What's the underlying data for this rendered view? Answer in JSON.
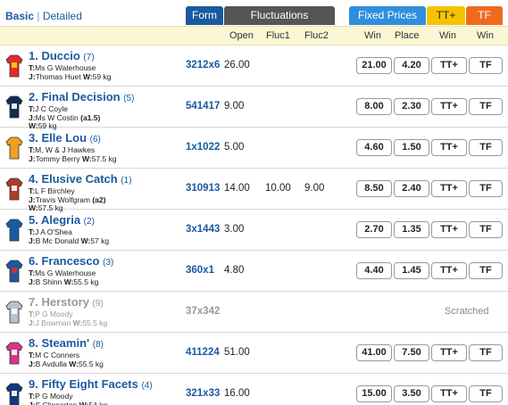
{
  "view_toggle": {
    "basic": "Basic",
    "separator": "|",
    "detailed": "Detailed"
  },
  "header_tabs": {
    "form": "Form",
    "fluctuations": "Fluctuations",
    "fixed_prices": "Fixed Prices",
    "tt_plus": "TT+",
    "tf": "TF"
  },
  "columns": {
    "open": "Open",
    "fluc1": "Fluc1",
    "fluc2": "Fluc2",
    "win": "Win",
    "place": "Place",
    "tt_win": "Win",
    "tf_win": "Win"
  },
  "colors": {
    "accent_blue": "#1a5aa0",
    "fixed_blue": "#2f8fdc",
    "tt_yellow": "#f6c300",
    "tf_orange": "#ee6a1e",
    "header_bg": "#fbf6d4"
  },
  "runners": [
    {
      "name": "1. Duccio",
      "barrier": "(7)",
      "trainer_label": "T:",
      "trainer": "Ms G Waterhouse",
      "jockey_label": "J:",
      "jockey": "Thomas Huet",
      "weight_label": "W:",
      "weight": "59 kg",
      "form": "3212x6",
      "open": "26.00",
      "fluc1": "",
      "fluc2": "",
      "win": "21.00",
      "place": "4.20",
      "tt": "TT+",
      "tf": "TF"
    },
    {
      "name": "2. Final Decision",
      "barrier": "(5)",
      "trainer_label": "T:",
      "trainer": "J C Coyle",
      "jockey_label": "J:",
      "jockey": "Ms W Costin",
      "claim": "(a1.5)",
      "weight_label": "W:",
      "weight": "59 kg",
      "form": "541417",
      "open": "9.00",
      "fluc1": "",
      "fluc2": "",
      "win": "8.00",
      "place": "2.30",
      "tt": "TT+",
      "tf": "TF"
    },
    {
      "name": "3. Elle Lou",
      "barrier": "(6)",
      "trainer_label": "T:",
      "trainer": "M, W & J Hawkes",
      "jockey_label": "J:",
      "jockey": "Tommy Berry",
      "weight_label": "W:",
      "weight": "57.5 kg",
      "form": "1x1022",
      "open": "5.00",
      "fluc1": "",
      "fluc2": "",
      "win": "4.60",
      "place": "1.50",
      "tt": "TT+",
      "tf": "TF"
    },
    {
      "name": "4. Elusive Catch",
      "barrier": "(1)",
      "trainer_label": "T:",
      "trainer": "L F Birchley",
      "jockey_label": "J:",
      "jockey": "Travis Wolfgram",
      "claim": "(a2)",
      "weight_label": "W:",
      "weight": "57.5 kg",
      "form": "310913",
      "open": "14.00",
      "fluc1": "10.00",
      "fluc2": "9.00",
      "win": "8.50",
      "place": "2.40",
      "tt": "TT+",
      "tf": "TF"
    },
    {
      "name": "5. Alegria",
      "barrier": "(2)",
      "trainer_label": "T:",
      "trainer": "J A O'Shea",
      "jockey_label": "J:",
      "jockey": "B Mc Donald",
      "weight_label": "W:",
      "weight": "57 kg",
      "form": "3x1443",
      "open": "3.00",
      "fluc1": "",
      "fluc2": "",
      "win": "2.70",
      "place": "1.35",
      "tt": "TT+",
      "tf": "TF"
    },
    {
      "name": "6. Francesco",
      "barrier": "(3)",
      "trainer_label": "T:",
      "trainer": "Ms G Waterhouse",
      "jockey_label": "J:",
      "jockey": "B Shinn",
      "weight_label": "W:",
      "weight": "55.5 kg",
      "form": "360x1",
      "open": "4.80",
      "fluc1": "",
      "fluc2": "",
      "win": "4.40",
      "place": "1.45",
      "tt": "TT+",
      "tf": "TF"
    },
    {
      "name": "7. Herstory",
      "barrier": "(9)",
      "trainer_label": "T:",
      "trainer": "P G Moody",
      "jockey_label": "J:",
      "jockey": "J Bowman",
      "weight_label": "W:",
      "weight": "55.5 kg",
      "form": "37x342",
      "scratched": "Scratched"
    },
    {
      "name": "8. Steamin'",
      "barrier": "(8)",
      "trainer_label": "T:",
      "trainer": "M C Conners",
      "jockey_label": "J:",
      "jockey": "B Avdulla",
      "weight_label": "W:",
      "weight": "55.5 kg",
      "form": "411224",
      "open": "51.00",
      "fluc1": "",
      "fluc2": "",
      "win": "41.00",
      "place": "7.50",
      "tt": "TT+",
      "tf": "TF"
    },
    {
      "name": "9. Fifty Eight Facets",
      "barrier": "(4)",
      "trainer_label": "T:",
      "trainer": "P G Moody",
      "jockey_label": "J:",
      "jockey": "S Clipperton",
      "weight_label": "W:",
      "weight": "54 kg",
      "form": "321x33",
      "open": "16.00",
      "fluc1": "",
      "fluc2": "",
      "win": "15.00",
      "place": "3.50",
      "tt": "TT+",
      "tf": "TF"
    }
  ]
}
